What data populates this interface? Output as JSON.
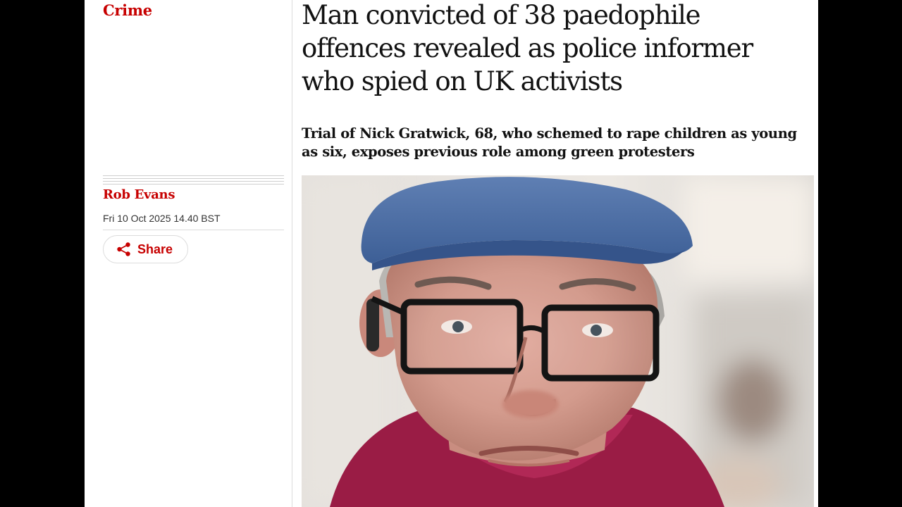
{
  "article": {
    "section": "Crime",
    "headline": "Man convicted of 38 paedophile offences revealed as police informer who spied on UK activists",
    "standfirst": "Trial of Nick Gratwick, 68, who schemed to rape children as young as six, exposes previous role among green protesters",
    "byline": "Rob Evans",
    "dateline": "Fri 10 Oct 2025 14.40 BST",
    "share_label": "Share"
  },
  "icons": {
    "share": "share-icon"
  },
  "colors": {
    "accent": "#c70000",
    "text": "#121212",
    "background": "#ffffff",
    "frame": "#000000"
  }
}
